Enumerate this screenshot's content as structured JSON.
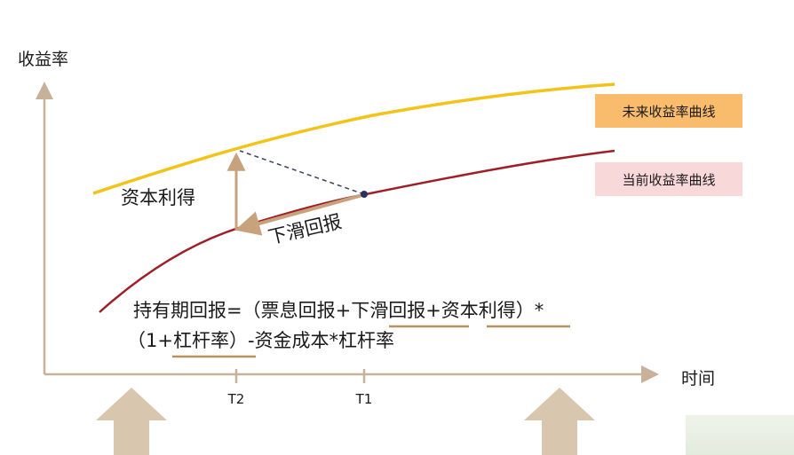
{
  "diagram": {
    "y_axis_label": "收益率",
    "x_axis_label": "时间",
    "ticks": {
      "t2": "T2",
      "t1": "T1"
    },
    "legend": {
      "future_curve": "未来收益率曲线",
      "current_curve": "当前收益率曲线"
    },
    "annotations": {
      "capital_gain": "资本利得",
      "rolldown": "下滑回报"
    },
    "formula": {
      "line1": "持有期回报=（票息回报+下滑回报+资本利得）*",
      "line2": "（1+杠杆率）-资金成本*杠杆率"
    },
    "colors": {
      "future_curve": "#F2C318",
      "current_curve": "#9E1F28",
      "axis": "#C7B299",
      "arrow": "#C8A27C",
      "up_arrows": "#D9C6AE",
      "legend_future_bg": "#F9BB6C",
      "legend_current_bg": "#F9D8DA",
      "dashed_line": "#3A3F5C",
      "t1_dot": "#2B2F66"
    }
  }
}
